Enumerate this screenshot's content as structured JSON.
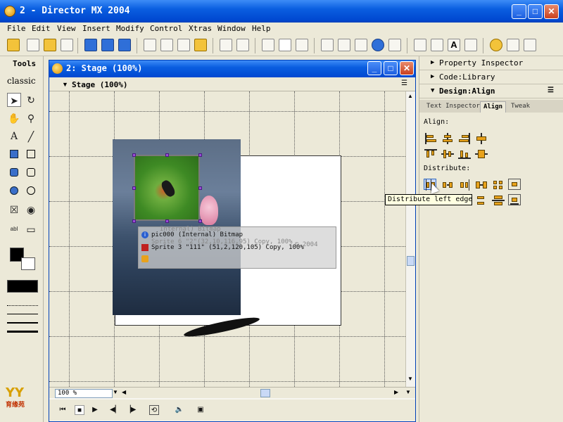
{
  "app": {
    "title": "2 - Director MX 2004"
  },
  "menu": [
    "File",
    "Edit",
    "View",
    "Insert",
    "Modify",
    "Control",
    "Xtras",
    "Window",
    "Help"
  ],
  "tools_panel": {
    "title": "Tools",
    "mode": "classic"
  },
  "stage": {
    "window_title": "2: Stage (100%)",
    "panel_title": "Stage (100%)",
    "zoom": "100 %",
    "overlay_lines": [
      "pic000 (Internal) Bitmap",
      "Sprite 6 \"2\"(32,10,116,95) Copy, 100%",
      "Sprite 3 \"111\" (51,2,120,105) Copy, 100%",
      "Copy, 100%",
      "Internal) Bitmap",
      "© 2004"
    ]
  },
  "panels": {
    "property_inspector": "Property Inspector",
    "code_library": "Code:Library",
    "design_align": "Design:Align",
    "tabs": [
      "Text Inspector",
      "Align",
      "Tweak"
    ],
    "active_tab": "Align",
    "align_label": "Align:",
    "distribute_label": "Distribute:"
  },
  "tooltip": "Distribute left edge",
  "logo": {
    "mark": "YY",
    "caption": "育缘苑"
  },
  "colors": {
    "titlebar": "#0a5ee0",
    "accent_orange": "#e8a21c",
    "handle_purple": "#9b4bd8"
  }
}
